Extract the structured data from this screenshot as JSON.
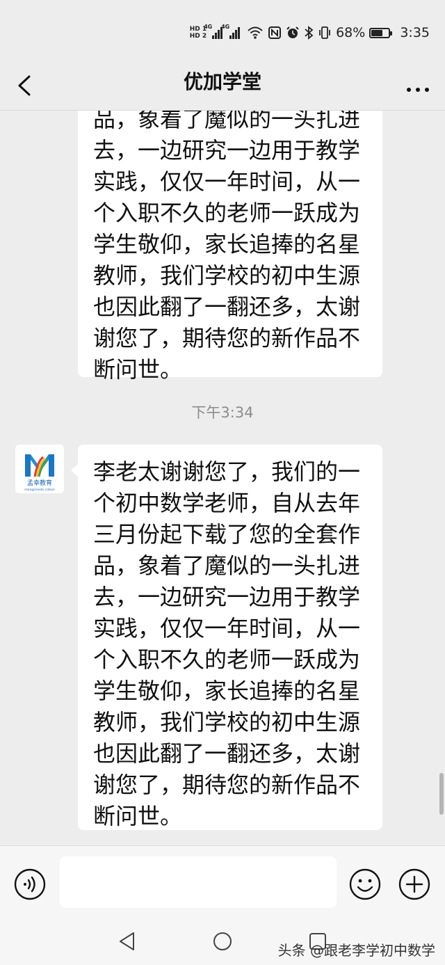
{
  "status_bar": {
    "hd1": "HD 1",
    "hd2": "HD 2",
    "net1": "4G",
    "net2": "4G",
    "battery_pct": "68%",
    "battery_level": 0.68,
    "time": "3:35"
  },
  "header": {
    "title": "优加学堂"
  },
  "messages": {
    "partial_lines": [
      "品，象着了魔似的一头扎进",
      "去，一边研究一边用于教学",
      "实践，仅仅一年时间，从一",
      "个入职不久的老师一跃成为",
      "学生敬仰，家长追捧的名星",
      "教师，我们学校的初中生源",
      "也因此翻了一翻还多，太谢",
      "谢您了，期待您的新作品不",
      "断问世。"
    ],
    "timestamp": "下午3:34",
    "avatar_text": "孟幸教育",
    "avatar_subtext": "mengxinedu cation",
    "full_lines": [
      "李老太谢谢您了，我们的一",
      "个初中数学老师，自从去年",
      "三月份起下载了您的全套作",
      "品，象着了魔似的一头扎进",
      "去，一边研究一边用于教学",
      "实践，仅仅一年时间，从一",
      "个入职不久的老师一跃成为",
      "学生敬仰，家长追捧的名星",
      "教师，我们学校的初中生源",
      "也因此翻了一翻还多，太谢",
      "谢您了，期待您的新作品不",
      "断问世。"
    ]
  },
  "input_bar": {
    "value": "",
    "placeholder": ""
  },
  "watermark": "头条 @跟老李学初中数学",
  "colors": {
    "background": "#ededed",
    "bubble": "#ffffff",
    "timestamp": "#8c8c8c"
  },
  "icons": [
    "back-arrow-icon",
    "more-icon",
    "voice-icon",
    "emoji-icon",
    "plus-icon",
    "nav-back-icon",
    "nav-home-icon",
    "nav-recent-icon"
  ]
}
